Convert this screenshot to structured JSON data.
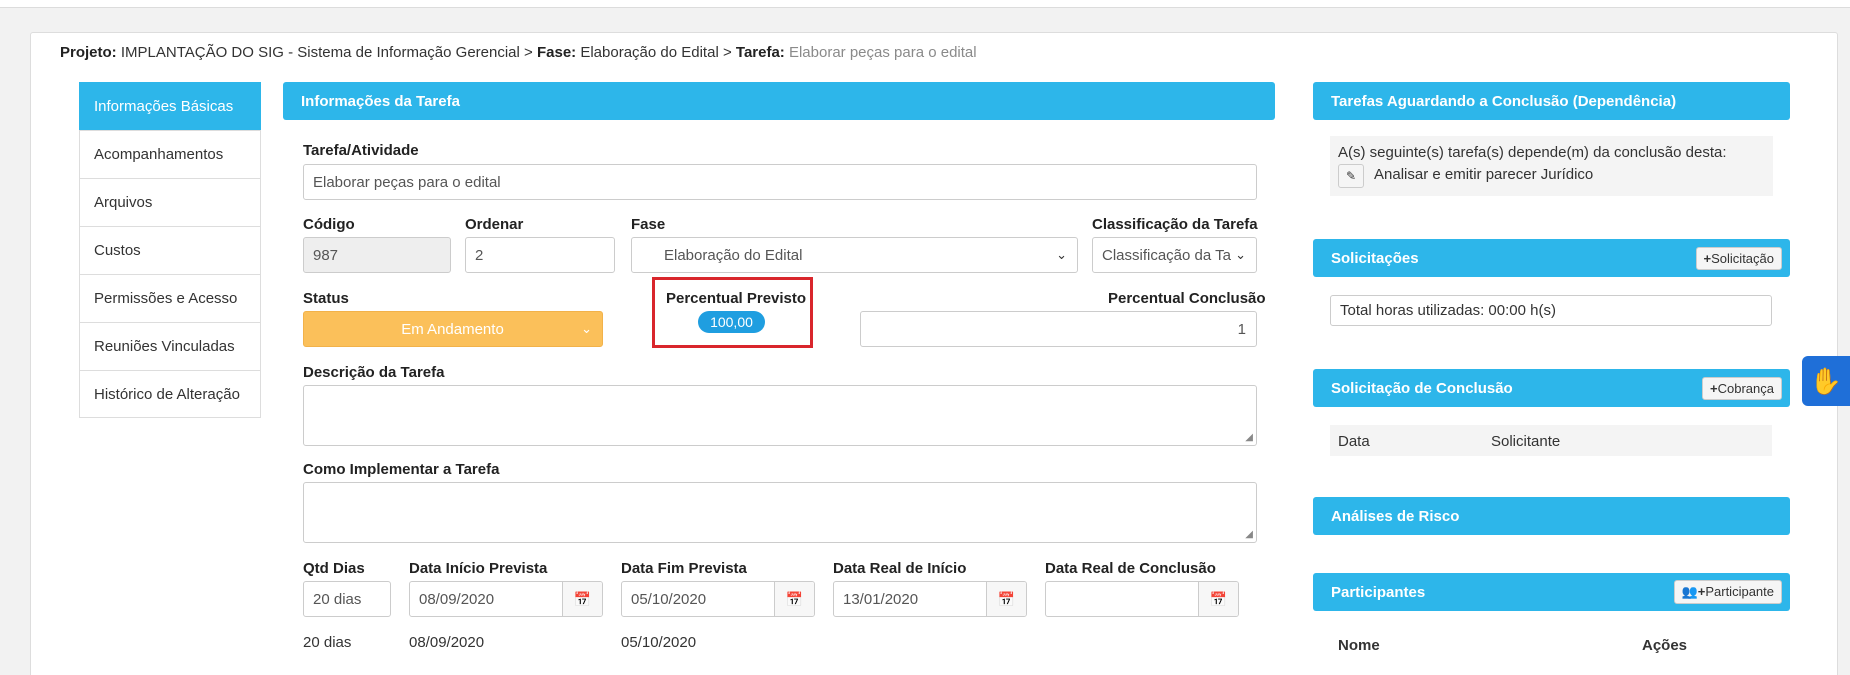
{
  "breadcrumb": {
    "projeto_label": "Projeto:",
    "projeto_value": "IMPLANTAÇÃO DO SIG - Sistema de Informação Gerencial",
    "sep1": ">",
    "fase_label": "Fase:",
    "fase_value": "Elaboração do Edital",
    "sep2": ">",
    "tarefa_label": "Tarefa:",
    "tarefa_value": "Elaborar peças para o edital"
  },
  "sidebar": {
    "items": [
      {
        "label": "Informações Básicas"
      },
      {
        "label": "Acompanhamentos"
      },
      {
        "label": "Arquivos"
      },
      {
        "label": "Custos"
      },
      {
        "label": "Permissões e Acesso"
      },
      {
        "label": "Reuniões Vinculadas"
      },
      {
        "label": "Histórico de Alteração"
      }
    ]
  },
  "task": {
    "panel_title": "Informações da Tarefa",
    "tarefa_label": "Tarefa/Atividade",
    "tarefa_value": "Elaborar peças para o edital",
    "codigo_label": "Código",
    "codigo_value": "987",
    "ordenar_label": "Ordenar",
    "ordenar_value": "2",
    "fase_label": "Fase",
    "fase_value": "Elaboração do Edital",
    "classificacao_label": "Classificação da Tarefa",
    "classificacao_value": "Classificação da Ta",
    "status_label": "Status",
    "status_value": "Em Andamento",
    "previsto_label": "Percentual Previsto",
    "previsto_value": "100,00",
    "conclusao_label": "Percentual Conclusão",
    "conclusao_value": "1",
    "descricao_label": "Descrição da Tarefa",
    "implementar_label": "Como Implementar a Tarefa",
    "qtd_label": "Qtd Dias",
    "qtd_value": "20 dias",
    "inicio_prev_label": "Data Início Prevista",
    "inicio_prev_value": "08/09/2020",
    "fim_prev_label": "Data Fim Prevista",
    "fim_prev_value": "05/10/2020",
    "inicio_real_label": "Data Real de Início",
    "inicio_real_value": "13/01/2020",
    "conclusao_real_label": "Data Real de Conclusão",
    "conclusao_real_value": "",
    "below_qtd": "20 dias",
    "below_inicio": "08/09/2020",
    "below_fim": "05/10/2020"
  },
  "dependencias": {
    "title": "Tarefas Aguardando a Conclusão (Dependência)",
    "text": "A(s) seguinte(s) tarefa(s) depende(m) da conclusão desta:",
    "item": "Analisar e emitir parecer Jurídico"
  },
  "solicitacoes": {
    "title": "Solicitações",
    "button": "Solicitação",
    "total": "Total horas utilizadas: 00:00 h(s)"
  },
  "solicitacao_conclusao": {
    "title": "Solicitação de Conclusão",
    "button": "Cobrança",
    "col_data": "Data",
    "col_solicitante": "Solicitante"
  },
  "analises": {
    "title": "Análises de Risco"
  },
  "participantes": {
    "title": "Participantes",
    "button": "Participante",
    "col_nome": "Nome",
    "col_acoes": "Ações"
  },
  "colors": {
    "accent": "#2db6ea",
    "status": "#fbc05a",
    "highlight": "#d9262c",
    "badge": "#1f9ee0"
  }
}
